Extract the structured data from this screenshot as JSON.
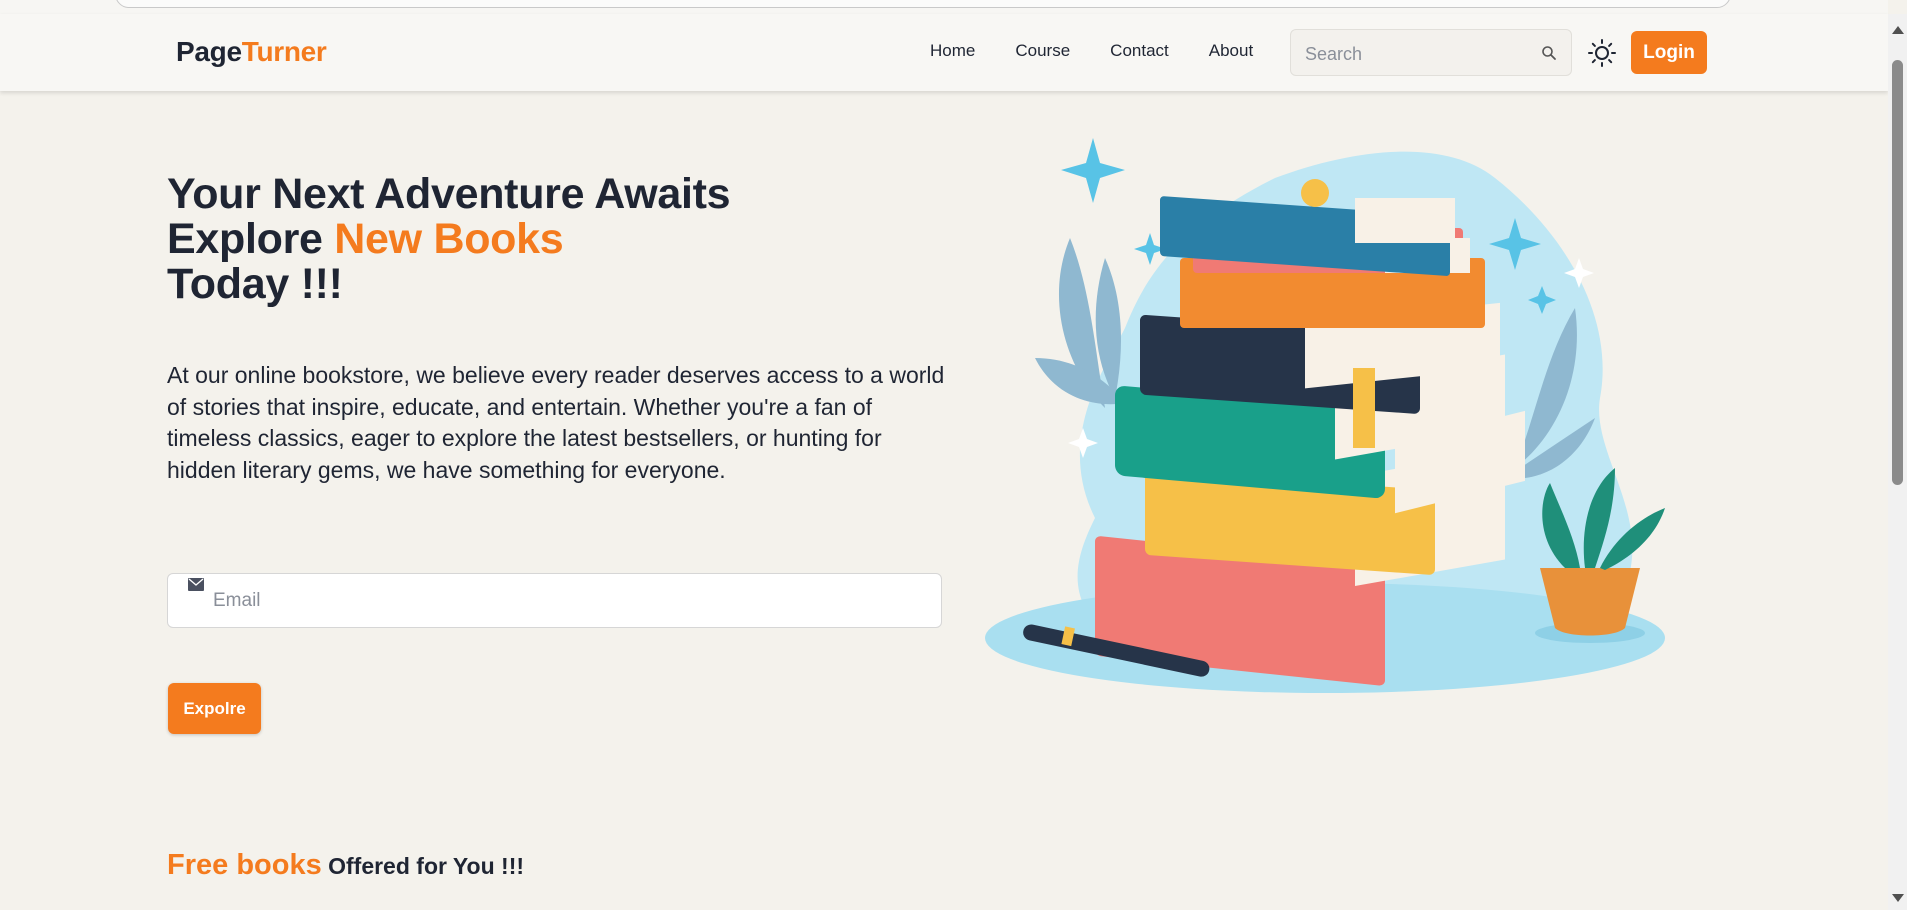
{
  "brand": {
    "part1": "Page",
    "part2": "Turner",
    "accent_color": "#f47b1e"
  },
  "nav": {
    "links": [
      {
        "label": "Home"
      },
      {
        "label": "Course"
      },
      {
        "label": "Contact"
      },
      {
        "label": "About"
      }
    ],
    "search_placeholder": "Search",
    "search_icon": "search-icon",
    "theme_icon": "sun-icon",
    "login_label": "Login"
  },
  "hero": {
    "line1": "Your Next Adventure Awaits",
    "line2_prefix": "Explore ",
    "line2_accent": "New Books",
    "line3": "Today !!!",
    "description": "At our online bookstore, we believe every reader deserves access to a world of stories that inspire, educate, and entertain. Whether you're a fan of timeless classics, eager to explore the latest bestsellers, or hunting for hidden literary gems, we have something for everyone.",
    "email_placeholder": "Email",
    "email_icon": "envelope-icon",
    "explore_label": "Expolre"
  },
  "free_section": {
    "accent": "Free books",
    "rest": " Offered for You !!!"
  },
  "colors": {
    "background": "#f4f2ec",
    "text": "#1f2533",
    "accent": "#f47b1e"
  }
}
